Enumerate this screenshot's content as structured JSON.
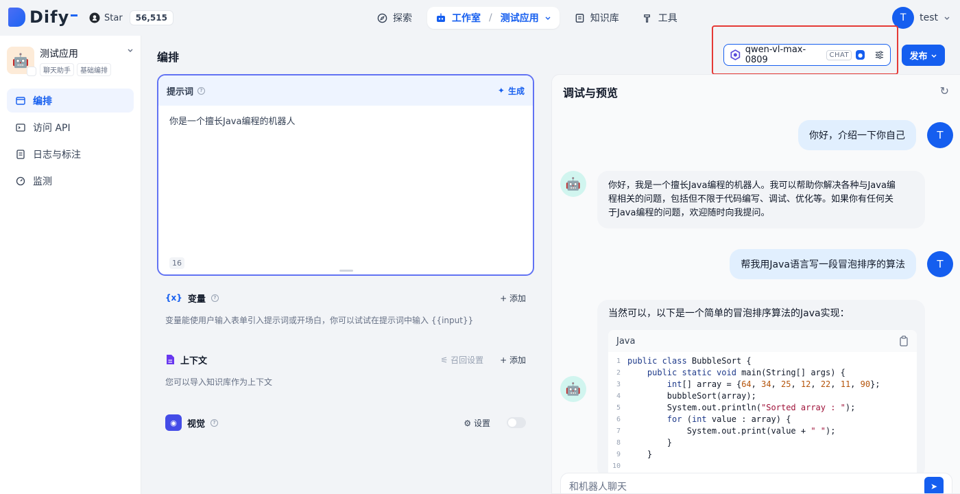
{
  "brand": {
    "logo_text": "Dify",
    "accent": "#155eef"
  },
  "github": {
    "star_label": "Star",
    "star_count": "56,515"
  },
  "nav": {
    "explore": "探索",
    "studio": "工作室",
    "current_app": "测试应用",
    "knowledge": "知识库",
    "tools": "工具"
  },
  "user": {
    "initial": "T",
    "name": "test"
  },
  "sidebar": {
    "app_name": "测试应用",
    "tags": [
      "聊天助手",
      "基础编排"
    ],
    "items": [
      {
        "label": "编排",
        "icon": "layout-icon"
      },
      {
        "label": "访问 API",
        "icon": "terminal-icon"
      },
      {
        "label": "日志与标注",
        "icon": "file-list-icon"
      },
      {
        "label": "监测",
        "icon": "gauge-icon"
      }
    ]
  },
  "main": {
    "title": "编排"
  },
  "model": {
    "name": "qwen-vl-max-0809",
    "mode": "CHAT"
  },
  "publish": {
    "label": "发布"
  },
  "prompt": {
    "label": "提示词",
    "generate": "生成",
    "text": "你是一个擅长Java编程的机器人",
    "count": "16"
  },
  "variables": {
    "label": "变量",
    "add": "添加",
    "desc": "变量能使用户输入表单引入提示词或开场白，你可以试试在提示词中输入 {{input}}"
  },
  "context": {
    "label": "上下文",
    "recall": "召回设置",
    "add": "添加",
    "desc": "您可以导入知识库作为上下文"
  },
  "vision": {
    "label": "视觉",
    "settings": "设置"
  },
  "debug": {
    "title": "调试与预览",
    "messages": [
      {
        "role": "user",
        "text": "你好，介绍一下你自己"
      },
      {
        "role": "bot",
        "lines": [
          "你好，我是一个擅长Java编程的机器人。我可以帮助你解决各种与Java编",
          "程相关的问题，包括但不限于代码编写、调试、优化等。如果你有任何关",
          "于Java编程的问题，欢迎随时向我提问。"
        ]
      },
      {
        "role": "user",
        "text": "帮我用Java语言写一段冒泡排序的算法"
      },
      {
        "role": "bot",
        "text": "当然可以，以下是一个简单的冒泡排序算法的Java实现："
      }
    ],
    "code_lang": "Java",
    "code_lines": [
      "1",
      "2",
      "3",
      "4",
      "5",
      "6",
      "7",
      "8",
      "9",
      "10"
    ],
    "composer_placeholder": "和机器人聊天"
  }
}
